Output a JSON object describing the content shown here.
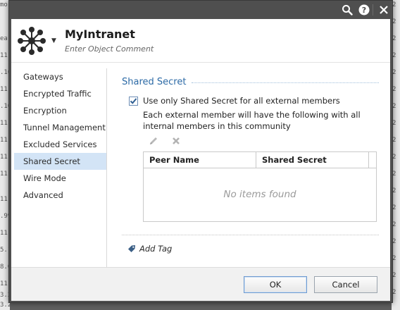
{
  "background": {
    "left_fragments": [
      "mo",
      "ea",
      "11",
      ".10",
      "11",
      ".10",
      "11",
      "11",
      "11",
      "11",
      "11",
      ".99",
      "11",
      "5.1",
      "8.0",
      "11",
      "3.2",
      "3.2"
    ],
    "right_fragments": [
      "2",
      "2",
      "2",
      "2",
      "2",
      "2",
      "2",
      "2",
      "2",
      "2",
      "2",
      "2",
      "2",
      "2",
      "2",
      "2",
      "2",
      "2"
    ]
  },
  "titlebar": {
    "icons": [
      "search-icon",
      "help-icon",
      "close-icon"
    ]
  },
  "header": {
    "object_name": "MyIntranet",
    "comment_placeholder": "Enter Object Comment"
  },
  "nav": {
    "items": [
      {
        "label": "Gateways"
      },
      {
        "label": "Encrypted Traffic"
      },
      {
        "label": "Encryption"
      },
      {
        "label": "Tunnel Management"
      },
      {
        "label": "Excluded Services"
      },
      {
        "label": "Shared Secret"
      },
      {
        "label": "Wire Mode"
      },
      {
        "label": "Advanced"
      }
    ],
    "active_label": "Shared Secret"
  },
  "content": {
    "section_title": "Shared Secret",
    "checkbox_label": "Use only Shared Secret for all external members",
    "checkbox_checked": true,
    "description": "Each external member will have the following with all internal members in this community",
    "toolbar_icons": [
      "edit-icon",
      "delete-icon"
    ],
    "table": {
      "columns": [
        "Peer Name",
        "Shared Secret"
      ],
      "rows": [],
      "empty_text": "No items found"
    },
    "add_tag_label": "Add Tag"
  },
  "footer": {
    "ok_label": "OK",
    "cancel_label": "Cancel"
  },
  "colors": {
    "titlebar": "#4f4f4f",
    "accent": "#2c6aa6",
    "nav_active": "#d3e4f6",
    "check_mark": "#2f5f93"
  }
}
